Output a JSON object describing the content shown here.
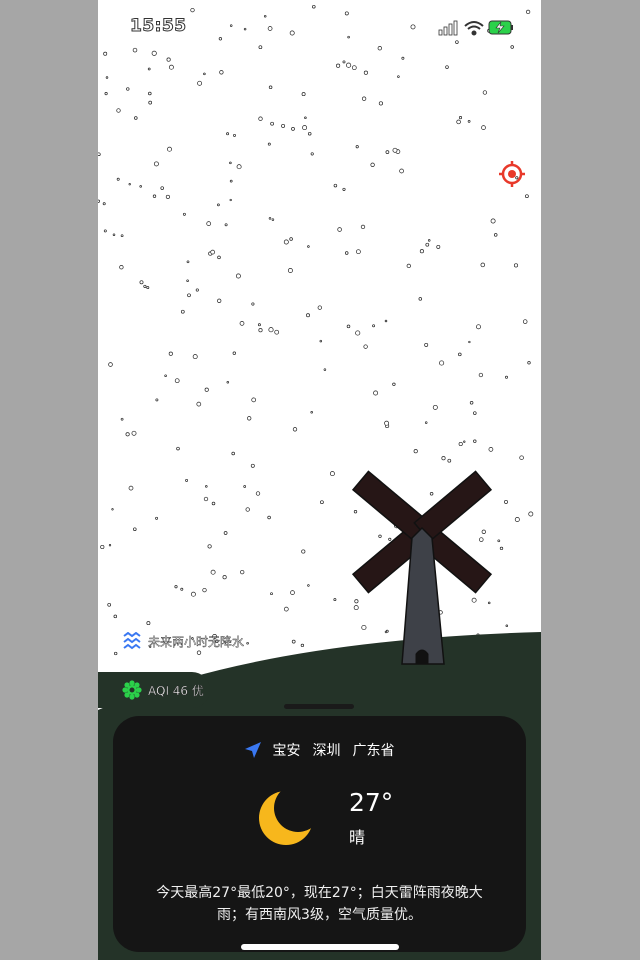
{
  "status_bar": {
    "time": "15:55"
  },
  "hints": {
    "rain": "未来两小时无降水",
    "aqi": "AQI 46 优"
  },
  "location": {
    "district": "宝安",
    "city": "深圳",
    "province": "广东省"
  },
  "weather": {
    "temperature": "27°",
    "condition": "晴",
    "summary": "今天最高27°最低20°，现在27°；白天雷阵雨夜晚大雨；有西南风3级，空气质量优。"
  },
  "icons": {
    "target": "crosshair-target-icon",
    "location": "navigation-arrow-icon",
    "rain": "wave-lines-icon",
    "aqi": "gear-flower-icon",
    "moon": "crescent-moon-icon"
  },
  "colors": {
    "hill": "#243328",
    "card": "#151515",
    "moon": "#f7b71c",
    "accent_blue": "#3a78f2",
    "target_red": "#e8392a",
    "aqi_green": "#2bd14a"
  }
}
